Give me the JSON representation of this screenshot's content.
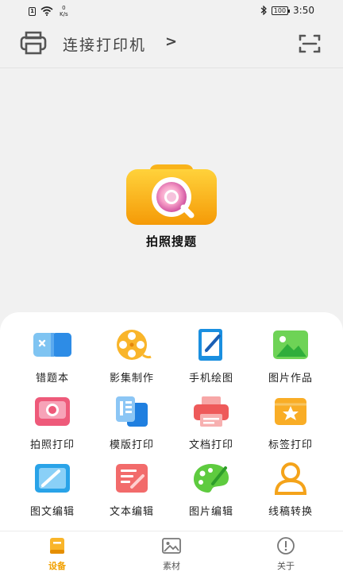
{
  "status_bar": {
    "sim": "1",
    "speed_value": "0",
    "speed_unit": "K/s",
    "battery": "100",
    "time": "3:50"
  },
  "header": {
    "connect_label": "连接打印机",
    "chevron": ">"
  },
  "hero": {
    "label": "拍照搜题"
  },
  "tools": [
    {
      "label": "错题本",
      "icon": "notebook-icon"
    },
    {
      "label": "影集制作",
      "icon": "film-reel-icon"
    },
    {
      "label": "手机绘图",
      "icon": "tablet-pen-icon"
    },
    {
      "label": "图片作品",
      "icon": "landscape-image-icon"
    },
    {
      "label": "拍照打印",
      "icon": "photo-print-icon"
    },
    {
      "label": "模版打印",
      "icon": "template-icon"
    },
    {
      "label": "文档打印",
      "icon": "printer-doc-icon"
    },
    {
      "label": "标签打印",
      "icon": "label-tag-icon"
    },
    {
      "label": "图文编辑",
      "icon": "image-edit-icon"
    },
    {
      "label": "文本编辑",
      "icon": "text-edit-icon"
    },
    {
      "label": "图片编辑",
      "icon": "palette-icon"
    },
    {
      "label": "线稿转换",
      "icon": "portrait-outline-icon"
    }
  ],
  "tabs": [
    {
      "label": "设备",
      "icon": "device-book-icon",
      "active": true
    },
    {
      "label": "素材",
      "icon": "image-frame-icon",
      "active": false
    },
    {
      "label": "关于",
      "icon": "info-circle-icon",
      "active": false
    }
  ],
  "colors": {
    "accent": "#f2a100",
    "background": "#f1f1f1",
    "card": "#ffffff"
  }
}
